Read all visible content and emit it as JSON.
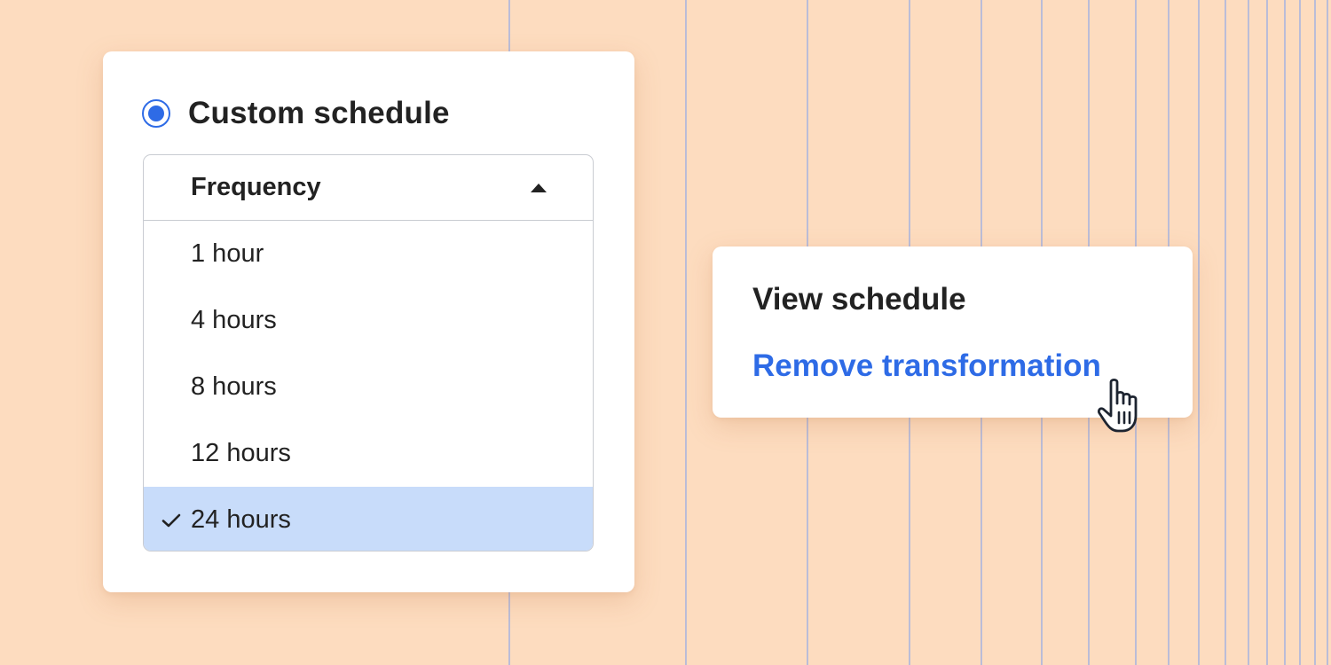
{
  "schedule_card": {
    "radio_label": "Custom schedule",
    "radio_selected": true,
    "dropdown": {
      "title": "Frequency",
      "expanded": true,
      "options": [
        {
          "label": "1 hour",
          "selected": false
        },
        {
          "label": "4 hours",
          "selected": false
        },
        {
          "label": "8 hours",
          "selected": false
        },
        {
          "label": "12 hours",
          "selected": false
        },
        {
          "label": "24 hours",
          "selected": true
        }
      ]
    }
  },
  "actions_card": {
    "view_label": "View schedule",
    "remove_label": "Remove transformation"
  },
  "icons": {
    "radio": "radio-selected-icon",
    "caret": "caret-up-icon",
    "check": "check-icon",
    "cursor": "hand-pointer-cursor-icon"
  },
  "colors": {
    "background": "#fddcbf",
    "accent": "#2e6be6",
    "selected_option": "#c8dcfa",
    "grid_lines": "#8fa8e8"
  }
}
